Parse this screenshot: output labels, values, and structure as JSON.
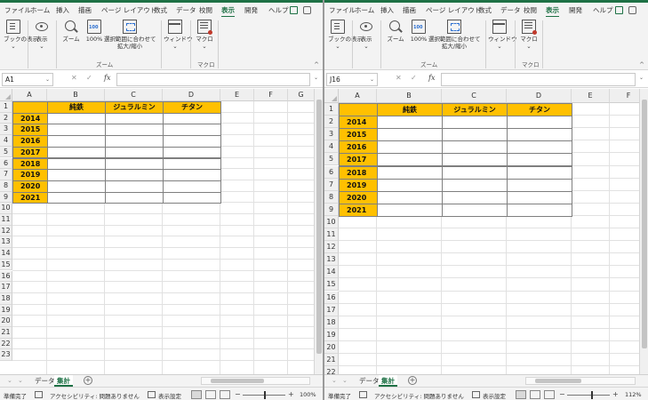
{
  "menu_tabs": [
    "ファイル",
    "ホーム",
    "挿入",
    "描画",
    "ページ レイアウト",
    "数式",
    "データ",
    "校閲",
    "表示",
    "開発",
    "ヘルプ"
  ],
  "active_menu_tab": "表示",
  "ribbon": {
    "book_view": "ブックの表示",
    "display": "表示",
    "zoom": "ズーム",
    "zoom100": "100%",
    "zoom_selection_line1": "選択範囲に合わせて",
    "zoom_selection_line2": "拡大/縮小",
    "window": "ウィンドウ",
    "macro": "マクロ",
    "group_zoom": "ズーム",
    "group_macro": "マクロ",
    "caret": "⌄",
    "collapse": "^"
  },
  "formula_bar": {
    "fx": "fx",
    "cancel": "✕",
    "enter": "✓"
  },
  "grid": {
    "columns": [
      "A",
      "B",
      "C",
      "D",
      "E",
      "F",
      "G"
    ],
    "rows": [
      "1",
      "2",
      "3",
      "4",
      "5",
      "6",
      "7",
      "8",
      "9",
      "10",
      "11",
      "12",
      "13",
      "14",
      "15",
      "16",
      "17",
      "18",
      "19",
      "20",
      "21",
      "22",
      "23"
    ],
    "table_headers": [
      "純鉄",
      "ジュラルミン",
      "チタン"
    ],
    "years": [
      "2014",
      "2015",
      "2016",
      "2017",
      "2018",
      "2019",
      "2020",
      "2021"
    ]
  },
  "sheets": [
    "データ",
    "集計"
  ],
  "active_sheet": "集計",
  "status": {
    "ready": "準備完了",
    "accessibility": "アクセシビリティ: 問題ありません",
    "display_settings": "表示設定",
    "zoom_minus": "−",
    "zoom_plus": "+"
  },
  "left_window": {
    "name_box": "A1",
    "zoom": "100%",
    "zoom_fraction": 0.5
  },
  "right_window": {
    "name_box": "J16",
    "zoom": "112%",
    "zoom_fraction": 0.56
  }
}
